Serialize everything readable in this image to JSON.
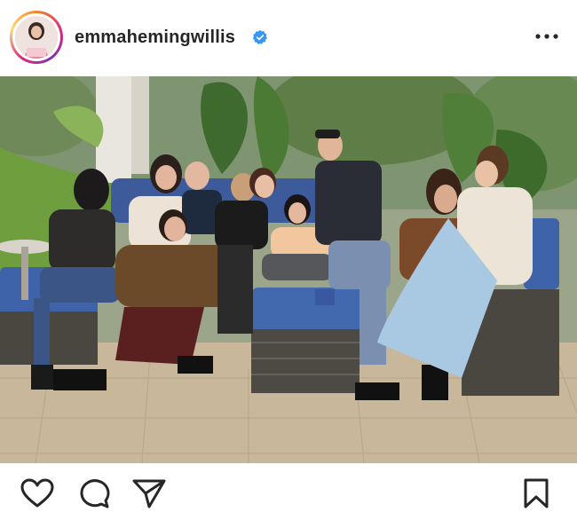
{
  "post": {
    "username": "emmahemingwillis",
    "verified": true
  },
  "icons": {
    "avatar": "profile-picture",
    "verified": "verified-badge-icon",
    "more": "more-options-icon",
    "like": "heart-icon",
    "comment": "comment-icon",
    "share": "send-icon",
    "save": "bookmark-icon"
  },
  "colors": {
    "verified_blue": "#3897f0",
    "text": "#262626"
  }
}
